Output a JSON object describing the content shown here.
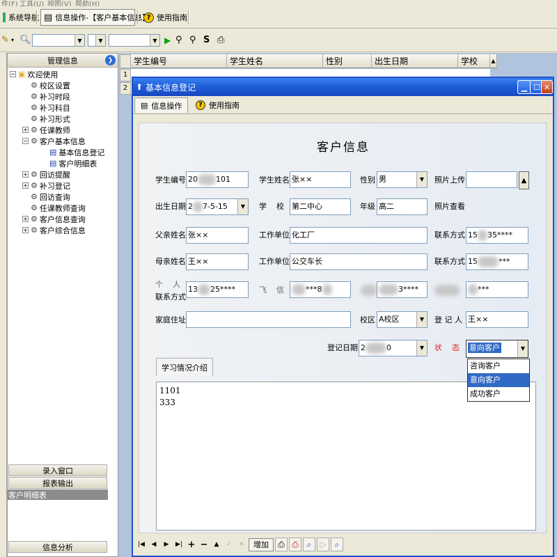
{
  "menubar": [
    "件(F)",
    "工具(U)",
    "视图(V)",
    "帮助(H)"
  ],
  "tabs": [
    {
      "label": "系统导航",
      "icon": "navigation-icon"
    },
    {
      "label": "信息操作-【客户基本信息】",
      "icon": "grid-icon",
      "active": true
    },
    {
      "label": "使用指南",
      "icon": "help-icon"
    }
  ],
  "left_panel": {
    "header": "管理信息",
    "tree": [
      {
        "label": "欢迎使用",
        "level": 0,
        "expander": "−",
        "icon": "folder-icon"
      },
      {
        "label": "校区设置",
        "level": 1,
        "icon": "tool-icon"
      },
      {
        "label": "补习时段",
        "level": 1,
        "icon": "tool-icon"
      },
      {
        "label": "补习科目",
        "level": 1,
        "icon": "tool-icon"
      },
      {
        "label": "补习形式",
        "level": 1,
        "icon": "tool-icon"
      },
      {
        "label": "任课教师",
        "level": 1,
        "expander": "+",
        "icon": "tool-icon"
      },
      {
        "label": "客户基本信息",
        "level": 1,
        "expander": "−",
        "icon": "tool-icon"
      },
      {
        "label": "基本信息登记",
        "level": 2,
        "icon": "document-icon"
      },
      {
        "label": "客户明细表",
        "level": 2,
        "icon": "document-icon"
      },
      {
        "label": "回访提醒",
        "level": 1,
        "expander": "+",
        "icon": "tool-icon"
      },
      {
        "label": "补习登记",
        "level": 1,
        "expander": "+",
        "icon": "tool-icon"
      },
      {
        "label": "回访查询",
        "level": 1,
        "icon": "tool-icon"
      },
      {
        "label": "任课教师查询",
        "level": 1,
        "icon": "tool-icon"
      },
      {
        "label": "客户信息查询",
        "level": 1,
        "expander": "+",
        "icon": "tool-icon"
      },
      {
        "label": "客户综合信息",
        "level": 1,
        "expander": "+",
        "icon": "tool-icon"
      }
    ],
    "btn_input": "录入窗口",
    "btn_report": "报表输出",
    "selected_report": "客户明细表",
    "btn_analysis": "信息分析"
  },
  "grid": {
    "columns": [
      "学生编号",
      "学生姓名",
      "性别",
      "出生日期",
      "学校"
    ],
    "row_headers": [
      "1",
      "2"
    ]
  },
  "dialog": {
    "title": "基本信息登记",
    "tabs": [
      "信息操作",
      "使用指南"
    ],
    "form_title": "客户信息",
    "labels": {
      "student_id": "学生编号",
      "student_name": "学生姓名",
      "gender": "性别",
      "photo_upload": "照片上传",
      "birth_date": "出生日期",
      "school": "学    校",
      "grade": "年级",
      "photo_view": "照片查看",
      "father_name": "父亲姓名",
      "work_unit": "工作单位",
      "contact": "联系方式",
      "mother_name": "母亲姓名",
      "personal_contact_1": "个    人",
      "personal_contact_2": "联系方式",
      "feixin": "飞    信",
      "address": "家庭住址",
      "campus": "校区",
      "registrar": "登 记 人",
      "reg_date": "登记日期",
      "status": "状    态"
    },
    "values": {
      "student_id_pre": "20",
      "student_id_post": "101",
      "student_name": "张××",
      "gender": "男",
      "birth_date_pre": "2",
      "birth_date_post": "7-5-15",
      "school": "第二中心",
      "grade": "高二",
      "father_name": "张××",
      "father_work": "化工厂",
      "father_contact_pre": "15",
      "father_contact_post": "35****",
      "mother_name": "王××",
      "mother_work": "公交车长",
      "mother_contact_pre": "15",
      "mother_contact_post": "***",
      "personal_contact_pre": "13",
      "personal_contact_post": "25****",
      "feixin_mid": "***8",
      "field3_post": "3****",
      "field4_post": "***",
      "address": "",
      "campus": "A校区",
      "registrar": "王××",
      "reg_date_pre": "2",
      "reg_date_post": "0",
      "status": "意向客户"
    },
    "status_options": [
      "咨询客户",
      "意向客户",
      "成功客户"
    ],
    "study_tab": "学习情况介绍",
    "study_text": "1101\n333",
    "nav": {
      "add": "增加"
    }
  }
}
